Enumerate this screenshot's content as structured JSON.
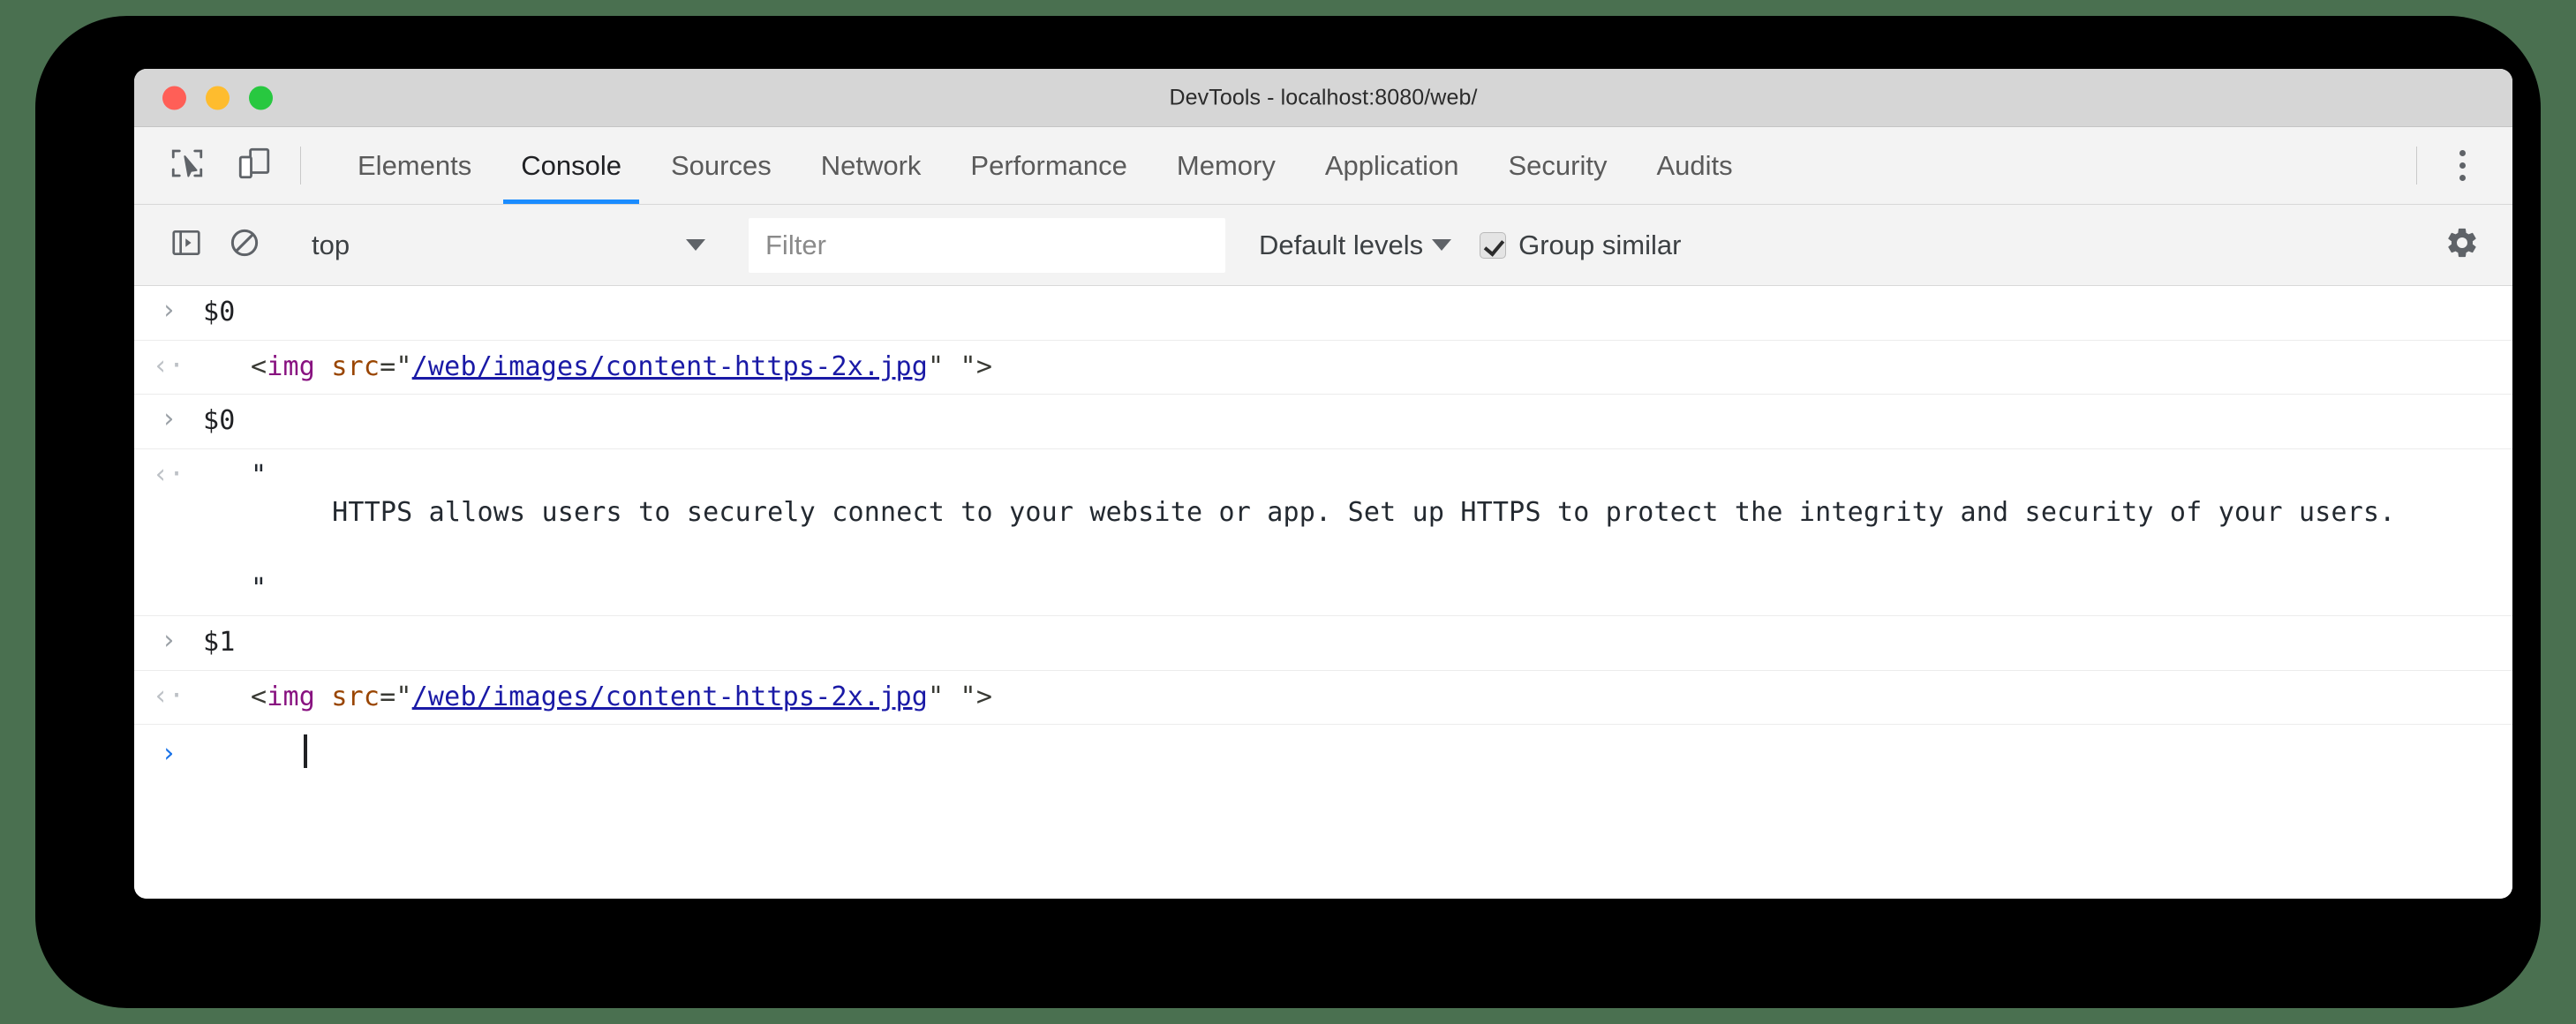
{
  "window": {
    "title": "DevTools - localhost:8080/web/",
    "traffic_lights": [
      {
        "name": "close",
        "color": "#ff5f57"
      },
      {
        "name": "minimize",
        "color": "#febc2e"
      },
      {
        "name": "zoom",
        "color": "#28c840"
      }
    ]
  },
  "theme": {
    "backdrop": "#4a7050",
    "frame": "#000000",
    "titlebar_bg": "#d6d6d6",
    "toolbar_bg": "#f3f3f3",
    "accent": "#1a8cff",
    "tag_color": "#881280",
    "attr_color": "#994500",
    "link_color": "#1a1aa6"
  },
  "tab_bar": {
    "inspect_icon": "inspect-element-icon",
    "device_icon": "toggle-device-toolbar-icon",
    "more_icon": "more-options-icon",
    "tabs": [
      {
        "label": "Elements",
        "active": false
      },
      {
        "label": "Console",
        "active": true
      },
      {
        "label": "Sources",
        "active": false
      },
      {
        "label": "Network",
        "active": false
      },
      {
        "label": "Performance",
        "active": false
      },
      {
        "label": "Memory",
        "active": false
      },
      {
        "label": "Application",
        "active": false
      },
      {
        "label": "Security",
        "active": false
      },
      {
        "label": "Audits",
        "active": false
      }
    ]
  },
  "console_toolbar": {
    "sidebar_icon": "console-sidebar-icon",
    "clear_icon": "clear-console-icon",
    "context": {
      "value": "top",
      "caret": "chevron-down-icon"
    },
    "filter": {
      "value": "",
      "placeholder": "Filter"
    },
    "levels": {
      "value": "Default levels",
      "caret": "chevron-down-icon"
    },
    "group_similar": {
      "label": "Group similar",
      "checked": true
    },
    "settings_icon": "gear-icon"
  },
  "console": {
    "entries": [
      {
        "type": "input",
        "marker": "input-chevron-icon",
        "text": "$0"
      },
      {
        "type": "output",
        "marker": "output-chevron-icon",
        "kind": "html",
        "parts": {
          "open": "<",
          "tag": "img",
          "space": " ",
          "attr": "src",
          "eq": "=\"",
          "link": "/web/images/content-https-2x.jpg",
          "close_quote": "\"",
          "trailing": " \"",
          "end": ">"
        }
      },
      {
        "type": "input",
        "marker": "input-chevron-icon",
        "text": "$0"
      },
      {
        "type": "output",
        "marker": "output-chevron-icon",
        "kind": "string",
        "quote_open": "\"",
        "body": "        HTTPS allows users to securely connect to your website or app. Set up HTTPS to protect the integrity and security of your users.",
        "quote_close": "\""
      },
      {
        "type": "input",
        "marker": "input-chevron-icon",
        "text": "$1"
      },
      {
        "type": "output",
        "marker": "output-chevron-icon",
        "kind": "html",
        "parts": {
          "open": "<",
          "tag": "img",
          "space": " ",
          "attr": "src",
          "eq": "=\"",
          "link": "/web/images/content-https-2x.jpg",
          "close_quote": "\"",
          "trailing": " \"",
          "end": ">"
        }
      }
    ],
    "prompt": {
      "marker": "prompt-chevron-icon",
      "value": ""
    }
  }
}
